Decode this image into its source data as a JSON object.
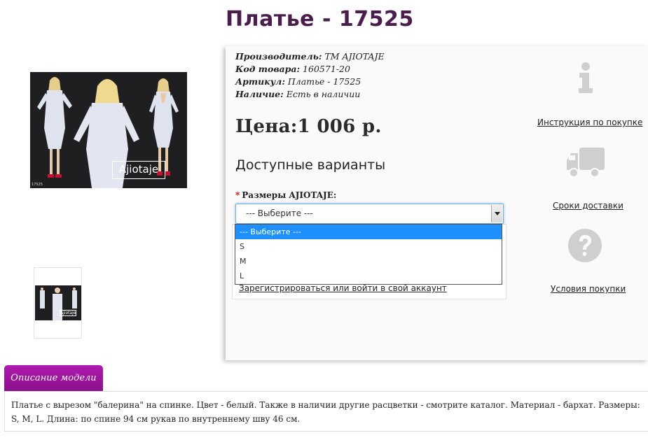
{
  "product": {
    "title": "Платье - 17525",
    "photo_brand": "Ajiotaje",
    "photo_code": "17525",
    "info": [
      {
        "label": "Производитель:",
        "value": " ТМ AJIOTAJE"
      },
      {
        "label": "Код товара:",
        "value": " 160571-20"
      },
      {
        "label": "Артикул:",
        "value": " Платье - 17525"
      },
      {
        "label": "Наличие:",
        "value": " Есть в наличии"
      }
    ],
    "price": "Цена:1 006 р."
  },
  "options": {
    "heading": "Доступные варианты",
    "size_label": "Размеры AJIOTAJE:",
    "required_mark": "*",
    "selected": "--- Выберите ---",
    "list": [
      "--- Выберите ---",
      "S",
      "M",
      "L"
    ]
  },
  "account": {
    "login_link": "Зарегистрироваться или войти в свой аккаунт"
  },
  "sidebar": {
    "instruction": "Инструкция по покупке",
    "delivery": "Сроки доставки",
    "terms": "Условия покупки"
  },
  "description": {
    "tab_label": "Описание модели",
    "text": "Платье с вырезом \"балерина\" на спинке. Цвет - белый. Также в наличии другие расцветки - смотрите каталог. Материал - бархат. Размеры: S, M, L. Длина: по спине 94 см рукав по внутреннему шву 46 см."
  },
  "colors": {
    "title": "#4a1d4e",
    "tab": "#9c149c",
    "highlight": "#1e90ff"
  }
}
